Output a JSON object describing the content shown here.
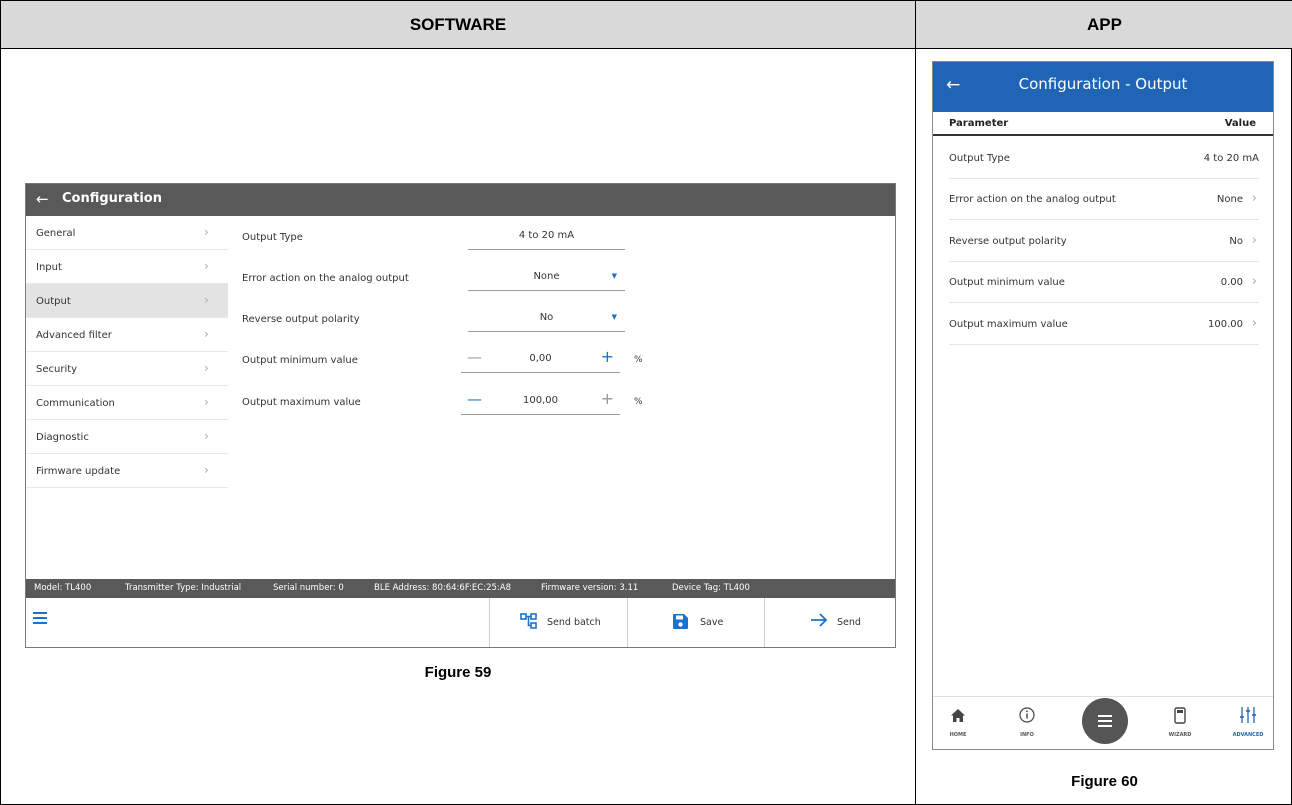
{
  "document": {
    "col_headers": [
      "SOFTWARE",
      "APP"
    ],
    "captions": [
      "Figure 59",
      "Figure 60"
    ]
  },
  "software": {
    "window_title": "Configuration",
    "menu": [
      {
        "label": "General",
        "active": false
      },
      {
        "label": "Input",
        "active": false
      },
      {
        "label": "Output",
        "active": true
      },
      {
        "label": "Advanced filter",
        "active": false
      },
      {
        "label": "Security",
        "active": false
      },
      {
        "label": "Communication",
        "active": false
      },
      {
        "label": "Diagnostic",
        "active": false
      },
      {
        "label": "Firmware update",
        "active": false
      }
    ],
    "params": {
      "output_type": {
        "label": "Output Type",
        "value": "4 to 20 mA"
      },
      "error_action": {
        "label": "Error action on the analog output",
        "value": "None"
      },
      "reverse_polarity": {
        "label": "Reverse output polarity",
        "value": "No"
      },
      "output_min": {
        "label": "Output minimum value",
        "value": "0,00",
        "unit": "%"
      },
      "output_max": {
        "label": "Output maximum value",
        "value": "100,00",
        "unit": "%"
      }
    },
    "status_bar": {
      "model": "Model: TL400",
      "transmitter_type": "Transmitter Type: Industrial",
      "serial": "Serial number: 0",
      "ble": "BLE Address: 80:64:6F:EC:25:A8",
      "firmware": "Firmware version: 3.11",
      "tag": "Device Tag: TL400"
    },
    "toolbar": {
      "send_batch": "Send batch",
      "save": "Save",
      "send": "Send"
    },
    "colors": {
      "title_bar": "#595959",
      "accent": "#1a73c8"
    }
  },
  "app": {
    "title": "Configuration - Output",
    "col_param": "Parameter",
    "col_value": "Value",
    "rows": {
      "output_type": {
        "label": "Output Type",
        "value": "4 to 20 mA"
      },
      "error_action": {
        "label": "Error action on the analog output",
        "value": "None"
      },
      "reverse_polarity": {
        "label": "Reverse output polarity",
        "value": "No"
      },
      "output_min": {
        "label": "Output minimum value",
        "value": "0.00"
      },
      "output_max": {
        "label": "Output maximum value",
        "value": "100.00"
      }
    },
    "nav": {
      "home": "HOME",
      "info": "INFO",
      "wizard": "WIZARD",
      "advanced": "ADVANCED"
    },
    "colors": {
      "header": "#1f64b5",
      "active_nav": "#1f64b5"
    }
  }
}
